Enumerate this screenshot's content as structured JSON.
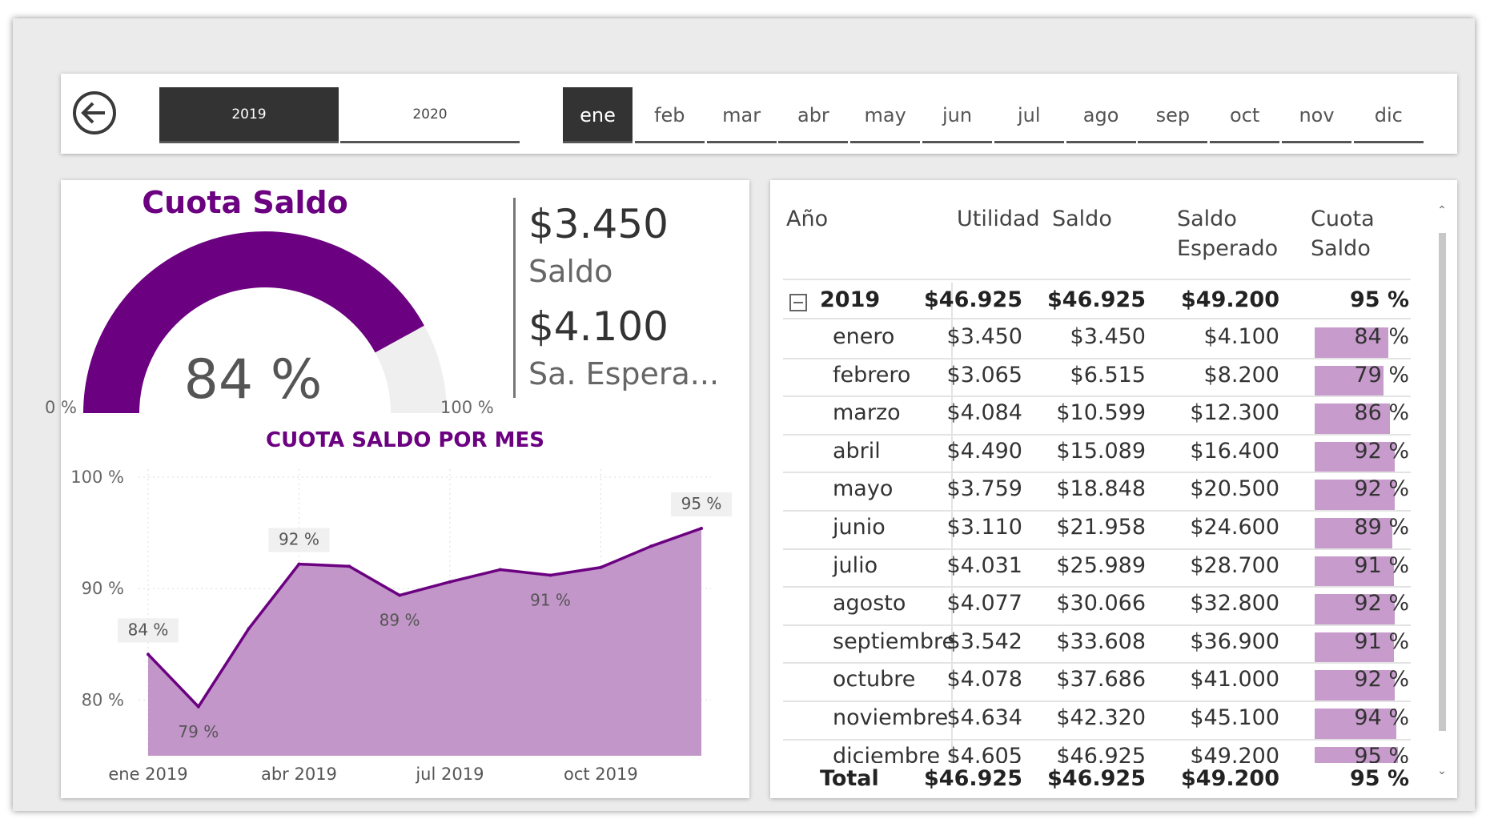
{
  "slicers": {
    "years": [
      {
        "label": "2019",
        "selected": true
      },
      {
        "label": "2020",
        "selected": false
      }
    ],
    "months": [
      {
        "label": "ene",
        "selected": true
      },
      {
        "label": "feb",
        "selected": false
      },
      {
        "label": "mar",
        "selected": false
      },
      {
        "label": "abr",
        "selected": false
      },
      {
        "label": "may",
        "selected": false
      },
      {
        "label": "jun",
        "selected": false
      },
      {
        "label": "jul",
        "selected": false
      },
      {
        "label": "ago",
        "selected": false
      },
      {
        "label": "sep",
        "selected": false
      },
      {
        "label": "oct",
        "selected": false
      },
      {
        "label": "nov",
        "selected": false
      },
      {
        "label": "dic",
        "selected": false
      }
    ]
  },
  "gauge": {
    "title": "Cuota Saldo",
    "value_label": "84 %",
    "value": 84,
    "min_label": "0 %",
    "max_label": "100 %",
    "min": 0,
    "max": 100,
    "fill_color": "#6b0080",
    "track_color": "#f0efef"
  },
  "cards": {
    "saldo_value": "$3.450",
    "saldo_label": "Saldo",
    "esperado_value": "$4.100",
    "esperado_label": "Sa. Espera..."
  },
  "chart_data": {
    "type": "area",
    "title": "CUOTA SALDO POR MES",
    "x": [
      "ene 2019",
      "feb 2019",
      "mar 2019",
      "abr 2019",
      "may 2019",
      "jun 2019",
      "jul 2019",
      "ago 2019",
      "sep 2019",
      "oct 2019",
      "nov 2019",
      "dic 2019"
    ],
    "xtick_labels": [
      "ene 2019",
      "abr 2019",
      "jul 2019",
      "oct 2019"
    ],
    "series": [
      {
        "values": [
          84.1,
          79.4,
          86.4,
          92.2,
          92.0,
          89.4,
          90.6,
          91.7,
          91.2,
          91.9,
          93.8,
          95.4
        ],
        "color": "#c396c9",
        "line_color": "#6b0080"
      }
    ],
    "data_labels": {
      "0": "84 %",
      "1": "79 %",
      "3": "92 %",
      "5": "89 %",
      "8": "91 %",
      "11": "95 %"
    },
    "ylim": [
      75,
      100
    ],
    "yticks": [
      {
        "value": 100,
        "label": "100 %"
      },
      {
        "value": 90,
        "label": "90 %"
      },
      {
        "value": 80,
        "label": "80 %"
      }
    ],
    "grid": true
  },
  "table": {
    "headers": {
      "anio": "Año",
      "utilidad": "Utilidad",
      "saldo": "Saldo",
      "saldo_esperado_1": "Saldo",
      "saldo_esperado_2": "Esperado",
      "cuota_1": "Cuota",
      "cuota_2": "Saldo"
    },
    "group": {
      "label": "2019",
      "utilidad": "$46.925",
      "saldo": "$46.925",
      "esperado": "$49.200",
      "cuota": "95 %"
    },
    "rows": [
      {
        "mes": "enero",
        "utilidad": "$3.450",
        "saldo": "$3.450",
        "esperado": "$4.100",
        "cuota": "84 %",
        "pct": 84
      },
      {
        "mes": "febrero",
        "utilidad": "$3.065",
        "saldo": "$6.515",
        "esperado": "$8.200",
        "cuota": "79 %",
        "pct": 79
      },
      {
        "mes": "marzo",
        "utilidad": "$4.084",
        "saldo": "$10.599",
        "esperado": "$12.300",
        "cuota": "86 %",
        "pct": 86
      },
      {
        "mes": "abril",
        "utilidad": "$4.490",
        "saldo": "$15.089",
        "esperado": "$16.400",
        "cuota": "92 %",
        "pct": 92
      },
      {
        "mes": "mayo",
        "utilidad": "$3.759",
        "saldo": "$18.848",
        "esperado": "$20.500",
        "cuota": "92 %",
        "pct": 92
      },
      {
        "mes": "junio",
        "utilidad": "$3.110",
        "saldo": "$21.958",
        "esperado": "$24.600",
        "cuota": "89 %",
        "pct": 89
      },
      {
        "mes": "julio",
        "utilidad": "$4.031",
        "saldo": "$25.989",
        "esperado": "$28.700",
        "cuota": "91 %",
        "pct": 91
      },
      {
        "mes": "agosto",
        "utilidad": "$4.077",
        "saldo": "$30.066",
        "esperado": "$32.800",
        "cuota": "92 %",
        "pct": 92
      },
      {
        "mes": "septiembre",
        "utilidad": "$3.542",
        "saldo": "$33.608",
        "esperado": "$36.900",
        "cuota": "91 %",
        "pct": 91
      },
      {
        "mes": "octubre",
        "utilidad": "$4.078",
        "saldo": "$37.686",
        "esperado": "$41.000",
        "cuota": "92 %",
        "pct": 92
      },
      {
        "mes": "noviembre",
        "utilidad": "$4.634",
        "saldo": "$42.320",
        "esperado": "$45.100",
        "cuota": "94 %",
        "pct": 94
      },
      {
        "mes": "diciembre",
        "utilidad": "$4.605",
        "saldo": "$46.925",
        "esperado": "$49.200",
        "cuota": "95 %",
        "pct": 95
      }
    ],
    "total": {
      "label": "Total",
      "utilidad": "$46.925",
      "saldo": "$46.925",
      "esperado": "$49.200",
      "cuota": "95 %"
    },
    "bar_color": "#c79bcc",
    "icons": {
      "collapse": "collapse-minus-icon",
      "back": "back-arrow-icon",
      "scroll_up": "chevron-up-icon",
      "scroll_down": "chevron-down-icon"
    }
  }
}
